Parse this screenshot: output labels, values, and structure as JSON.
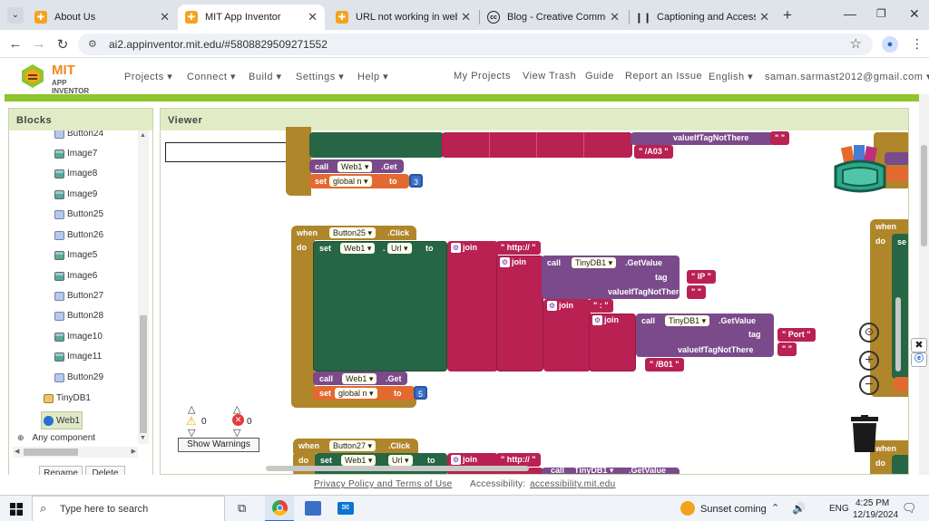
{
  "browser": {
    "tabs": [
      {
        "title": "About Us",
        "icon": "puzzle-icon"
      },
      {
        "title": "MIT App Inventor",
        "icon": "puzzle-icon"
      },
      {
        "title": "URL not working in webview",
        "icon": "puzzle-icon"
      },
      {
        "title": "Blog - Creative Commons",
        "icon": "cc-icon"
      },
      {
        "title": "Captioning and Accessibility",
        "icon": "captioning-icon"
      }
    ],
    "url": "ai2.appinventor.mit.edu/#5808829509271552"
  },
  "app": {
    "logo_text_top": "MIT",
    "logo_text_bottom": "APP INVENTOR",
    "menus": [
      "Projects ▾",
      "Connect ▾",
      "Build ▾",
      "Settings ▾",
      "Help ▾"
    ],
    "right_links": [
      "My Projects",
      "View Trash",
      "Guide",
      "Report an Issue",
      "English ▾",
      "saman.sarmast2012@gmail.com ▾"
    ]
  },
  "blocks_panel": {
    "title": "Blocks",
    "items": [
      "Button24",
      "Image7",
      "Image8",
      "Image9",
      "Button25",
      "Button26",
      "Image5",
      "Image6",
      "Button27",
      "Button28",
      "Image10",
      "Image11",
      "Button29",
      "TinyDB1",
      "Web1",
      "Any component"
    ],
    "rename": "Rename",
    "delete": "Delete"
  },
  "viewer": {
    "title": "Viewer",
    "warnings_count": "0",
    "errors_count": "0",
    "show_warnings": "Show Warnings",
    "blocks": {
      "top": {
        "valueIfTagNotThere": "valueIfTagNotThere",
        "a03": "\" /A03 \"",
        "call": "call",
        "web1": "Web1 ▾",
        "get": ".Get",
        "set": "set",
        "global_n": "global n ▾",
        "to": "to",
        "num": "3"
      },
      "main": {
        "when": "when",
        "do": "do",
        "button": "Button25 ▾",
        "click": ".Click",
        "set": "set",
        "web1": "Web1 ▾",
        "url": "Url ▾",
        "to": "to",
        "join": "join",
        "http": "\" http:// \"",
        "call": "call",
        "tinydb": "TinyDB1 ▾",
        "getvalue": ".GetValue",
        "tag": "tag",
        "ip": "\" IP \"",
        "valueIfTagNotThere": "valueIfTagNotThere",
        "empty": "\"  \"",
        "colon": "\" : \"",
        "port": "\" Port \"",
        "b01": "\" /B01 \"",
        "get": ".Get",
        "global_n": "global n ▾",
        "num": "5"
      },
      "bottom": {
        "when": "when",
        "button": "Button27 ▾",
        "click": ".Click",
        "do": "do",
        "set": "set",
        "web1": "Web1 ▾",
        "url": "Url ▾",
        "to": "to",
        "join": "join",
        "http": "\" http:// \"",
        "call": "call",
        "tinydb": "TinyDB1 ▾",
        "getvalue": ".GetValue"
      },
      "right": {
        "when": "when",
        "do": "do",
        "set_stub": "se"
      }
    }
  },
  "footer": {
    "privacy": "Privacy Policy and Terms of Use",
    "access_label": "Accessibility:",
    "access_link": "accessibility.mit.edu"
  },
  "taskbar": {
    "search": "Type here to search",
    "weather": "Sunset coming",
    "lang": "ENG",
    "time": "4:25 PM",
    "date": "12/19/2024"
  },
  "colors": {
    "green_bar": "#8dc52c",
    "event_block": "#b0862a",
    "component_block": "#266645",
    "text_block": "#b92153",
    "tinydb_block": "#7a4a8a",
    "variable_block": "#e26a30",
    "math_block": "#3a6fc7"
  }
}
